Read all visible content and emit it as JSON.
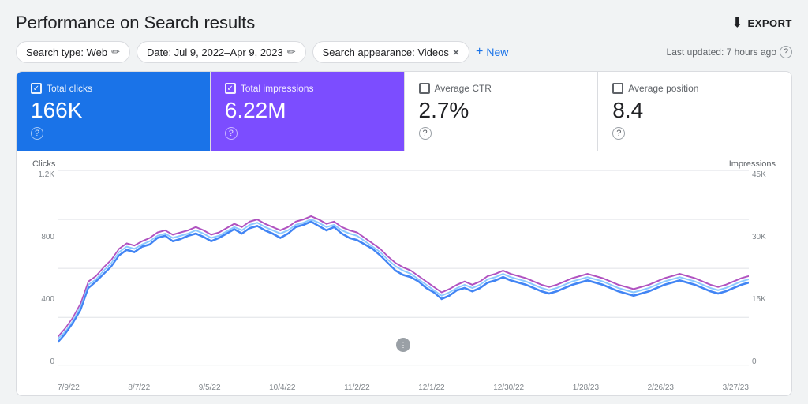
{
  "header": {
    "title": "Performance on Search results",
    "export_label": "EXPORT"
  },
  "filters": [
    {
      "id": "search-type",
      "label": "Search type: Web",
      "has_edit": true,
      "has_close": false
    },
    {
      "id": "date",
      "label": "Date: Jul 9, 2022–Apr 9, 2023",
      "has_edit": true,
      "has_close": false
    },
    {
      "id": "search-appearance",
      "label": "Search appearance: Videos",
      "has_edit": false,
      "has_close": true
    }
  ],
  "new_button_label": "New",
  "last_updated": "Last updated: 7 hours ago",
  "metrics": [
    {
      "id": "total-clicks",
      "label": "Total clicks",
      "value": "166K",
      "active": true,
      "style": "blue"
    },
    {
      "id": "total-impressions",
      "label": "Total impressions",
      "value": "6.22M",
      "active": true,
      "style": "purple"
    },
    {
      "id": "average-ctr",
      "label": "Average CTR",
      "value": "2.7%",
      "active": false,
      "style": "none"
    },
    {
      "id": "average-position",
      "label": "Average position",
      "value": "8.4",
      "active": false,
      "style": "none"
    }
  ],
  "chart": {
    "left_axis_label": "Clicks",
    "right_axis_label": "Impressions",
    "left_axis_values": [
      "1.2K",
      "800",
      "400",
      "0"
    ],
    "right_axis_values": [
      "45K",
      "30K",
      "15K",
      "0"
    ],
    "x_axis_labels": [
      "7/9/22",
      "8/7/22",
      "9/5/22",
      "10/4/22",
      "11/2/22",
      "12/1/22",
      "12/30/22",
      "1/28/23",
      "2/26/23",
      "3/27/23"
    ]
  },
  "colors": {
    "blue_active": "#1a73e8",
    "purple_active": "#7c4dff",
    "chart_blue": "#4285f4",
    "chart_purple": "#9c27b0",
    "chart_light_blue": "#81c4ff"
  }
}
